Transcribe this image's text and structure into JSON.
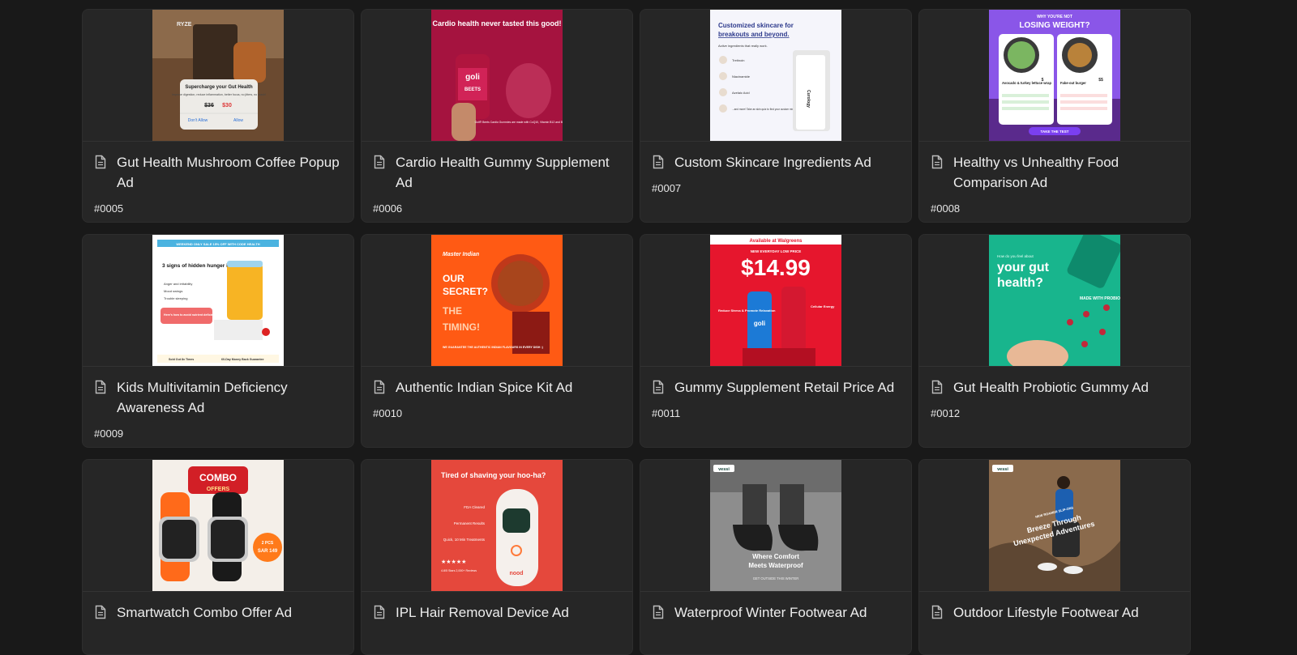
{
  "cards": [
    {
      "title": "Gut Health Mushroom Coffee Popup Ad",
      "id": "#0005",
      "thumb": "mushroom-coffee",
      "thumb_text": {
        "brand": "RYZE",
        "headline": "Supercharge your Gut Health",
        "body": "Improve digestion, reduce inflammation, better focus, no jitters, no crash!",
        "old_price": "$36",
        "new_price": "$30",
        "deny": "Don't Allow",
        "allow": "Allow"
      }
    },
    {
      "title": "Cardio Health Gummy Supplement Ad",
      "id": "#0006",
      "thumb": "cardio-gummy",
      "thumb_text": {
        "headline": "Cardio health never tasted this good!",
        "brand": "goli",
        "product": "BEETS",
        "body": "Goli® Beets Cardio Gummies are made with CoQ10, Vitamin B12 and Beet Root Extract"
      }
    },
    {
      "title": "Custom Skincare Ingredients Ad",
      "id": "#0007",
      "thumb": "skincare",
      "thumb_text": {
        "headline1": "Customized skincare for",
        "headline2": "breakouts and beyond.",
        "sub": "Active ingredients that really work.",
        "i1": "Tretinoin",
        "i2": "Niacinamide",
        "i3": "Azelaic Acid",
        "i4": "...and more! Take an skin quiz to find your custom mix.",
        "brand": "Curology"
      }
    },
    {
      "title": "Healthy vs Unhealthy Food Comparison Ad",
      "id": "#0008",
      "thumb": "food-compare",
      "thumb_text": {
        "top": "WHY YOU'RE NOT",
        "headline": "LOSING WEIGHT?",
        "left": "Avocado & turkey lettuce wrap",
        "right": "Fake-out burger",
        "price_l": "$",
        "price_r": "$$",
        "cta": "TAKE THE TEST"
      }
    },
    {
      "title": "Kids Multivitamin Deficiency Awareness Ad",
      "id": "#0009",
      "thumb": "kids-vitamin",
      "thumb_text": {
        "banner": "WEEKEND ONLY SALE 15% OFF WITH CODE HEALTH",
        "headline": "3 signs of hidden hunger in kids:",
        "b1": "Anger and irritability",
        "b2": "Mood swings",
        "b3": "Trouble sleeping",
        "cta": "Here's how to avoid nutrient deficiencies",
        "f1": "Sold Out 8x Times",
        "f2": "60-Day Money Back Guarantee"
      }
    },
    {
      "title": "Authentic Indian Spice Kit Ad",
      "id": "#0010",
      "thumb": "indian-spice",
      "thumb_text": {
        "brand": "Master Indian",
        "l1": "OUR",
        "l2": "SECRET?",
        "l3": "THE",
        "l4": "TIMING!",
        "foot": "WE GUARANTEE THE AUTHENTIC INDIAN FLAVOURS IN EVERY DISH :)"
      }
    },
    {
      "title": "Gummy Supplement Retail Price Ad",
      "id": "#0011",
      "thumb": "retail-price",
      "thumb_text": {
        "top": "Available at Walgreens",
        "sub": "NEW EVERYDAY LOW PRICE",
        "price": "$14.99",
        "left": "Reduce Stress & Promote Relaxation",
        "right": "Cellular Energy",
        "brand": "goli"
      }
    },
    {
      "title": "Gut Health Probiotic Gummy Ad",
      "id": "#0012",
      "thumb": "probiotic",
      "thumb_text": {
        "q": "How do you feel about",
        "headline1": "your gut",
        "headline2": "health?",
        "side": "MADE WITH PROBIOTICS"
      }
    },
    {
      "title": "Smartwatch Combo Offer Ad",
      "id": "",
      "thumb": "smartwatch",
      "thumb_text": {
        "l1": "COMBO",
        "l2": "OFFERS",
        "pcs": "2 PCS",
        "price": "SAR 149"
      }
    },
    {
      "title": "IPL Hair Removal Device Ad",
      "id": "",
      "thumb": "ipl",
      "thumb_text": {
        "headline": "Tired of shaving your hoo-ha?",
        "p1": "FDA Cleared",
        "p2": "Permanent Results",
        "p3": "Quick, 10 Min Treatments",
        "stars": "★★★★★",
        "rating": "4.8/5 Stars 2,000+ Reviews",
        "brand": "nood"
      }
    },
    {
      "title": "Waterproof Winter Footwear Ad",
      "id": "",
      "thumb": "winter-shoe",
      "thumb_text": {
        "brand": "vessi",
        "headline1": "Where Comfort",
        "headline2": "Meets Waterproof",
        "sub": "GET OUTSIDE THIS WINTER"
      }
    },
    {
      "title": "Outdoor Lifestyle Footwear Ad",
      "id": "",
      "thumb": "outdoor-shoe",
      "thumb_text": {
        "brand": "vessi",
        "small": "NEW ROAMER SLIP-ONS",
        "headline1": "Breeze Through",
        "headline2": "Unexpected Adventures"
      }
    }
  ]
}
